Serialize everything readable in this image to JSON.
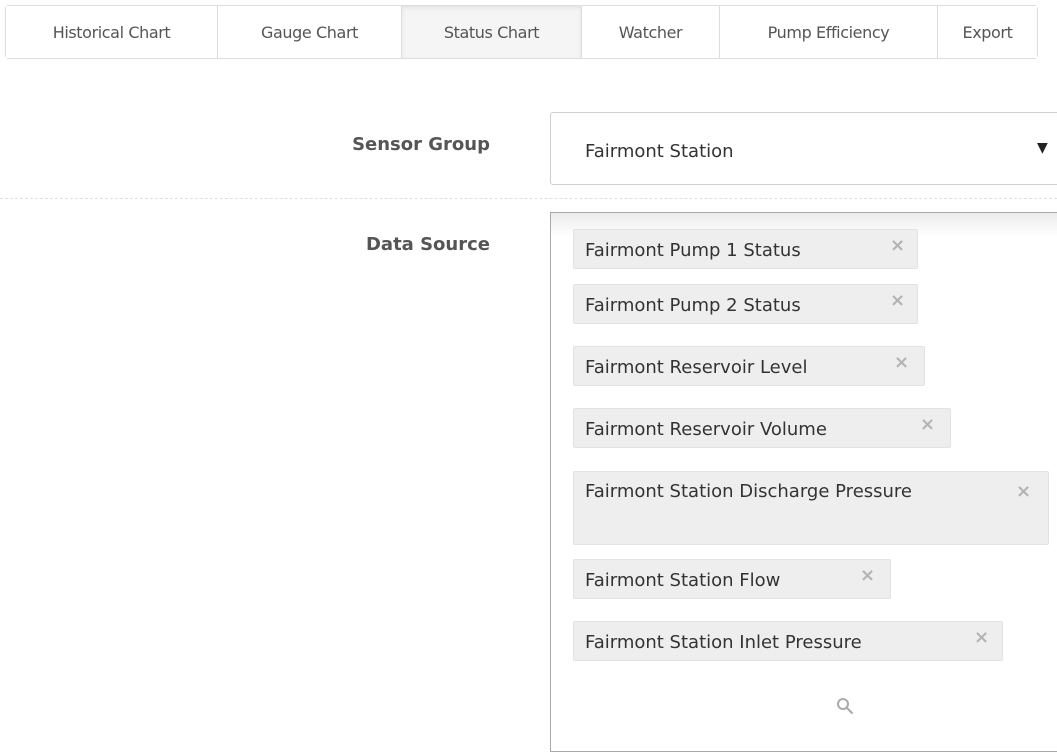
{
  "tabs": [
    {
      "label": "Historical Chart"
    },
    {
      "label": "Gauge Chart"
    },
    {
      "label": "Status Chart",
      "active": true
    },
    {
      "label": "Watcher"
    },
    {
      "label": "Pump Efficiency"
    },
    {
      "label": "Export"
    }
  ],
  "sensor_group": {
    "label": "Sensor Group",
    "selected": "Fairmont Station",
    "caret_icon": "caret-down-icon"
  },
  "data_source": {
    "label": "Data Source",
    "selected_items": [
      "Fairmont Pump 1 Status",
      "Fairmont Pump 2 Status",
      "Fairmont Reservoir Level",
      "Fairmont Reservoir Volume",
      "Fairmont Station Discharge Pressure",
      "Fairmont Station Flow",
      "Fairmont Station Inlet Pressure"
    ],
    "remove_icon": "close-icon",
    "search_icon": "search-icon"
  },
  "colors": {
    "active_tab_bg": "#f5f5f5",
    "chip_bg": "#eeeeee",
    "remove_icon": "#b3b3b3"
  }
}
